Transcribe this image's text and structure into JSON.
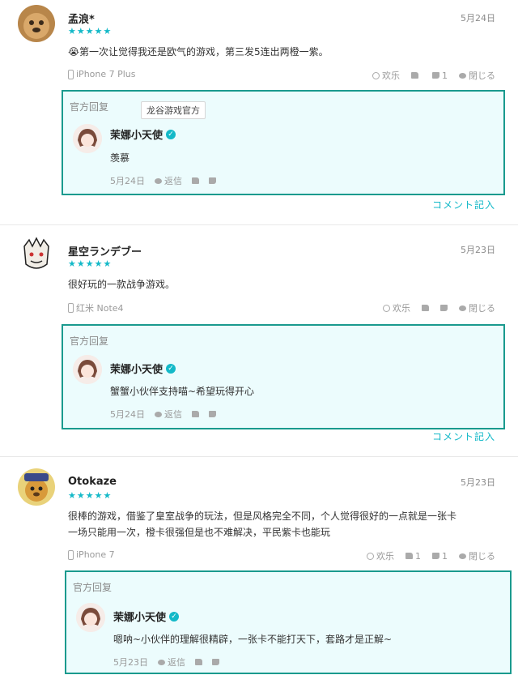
{
  "reviews": [
    {
      "username": "孟浪*",
      "date": "5月24日",
      "stars": "★★★★★",
      "emoji": "😭",
      "text": "第一次让觉得我还是欧气的游戏，第三发5连出两橙一紫。",
      "device": "iPhone 7 Plus",
      "fun_label": "欢乐",
      "like_count": "",
      "dislike_count": "1",
      "close_label": "閉じる",
      "reply": {
        "label": "官方回复",
        "tag": "龙谷游戏官方",
        "name": "茉娜小天使",
        "text": "羡慕",
        "date": "5月24日",
        "reply_label": "返信"
      },
      "comment_link": "コメント記入"
    },
    {
      "username": "星空ランデブー",
      "date": "5月23日",
      "stars": "★★★★★",
      "text": "很好玩的一款战争游戏。",
      "device": "红米 Note4",
      "fun_label": "欢乐",
      "like_count": "",
      "dislike_count": "",
      "close_label": "閉じる",
      "reply": {
        "label": "官方回复",
        "name": "茉娜小天使",
        "text": "蟹蟹小伙伴支持喵~希望玩得开心",
        "date": "5月24日",
        "reply_label": "返信"
      },
      "comment_link": "コメント記入"
    },
    {
      "username": "Otokaze",
      "date": "5月23日",
      "stars": "★★★★★",
      "text_line1": "很棒的游戏，借鉴了皇室战争的玩法，但是风格完全不同，个人觉得很好的一点就是一张卡",
      "text_line2": "一场只能用一次，橙卡很强但是也不难解决，平民紫卡也能玩",
      "device": "iPhone 7",
      "fun_label": "欢乐",
      "like_count": "1",
      "dislike_count": "1",
      "close_label": "閉じる",
      "reply": {
        "label": "官方回复",
        "name": "茉娜小天使",
        "text": "嗯呐~小伙伴的理解很精辟，一张卡不能打天下，套路才是正解~",
        "date": "5月23日",
        "reply_label": "返信"
      }
    }
  ],
  "colors": {
    "accent": "#14b9c8",
    "reply_border": "#1a9a8e",
    "reply_bg": "#ecfcfd"
  },
  "icons": [
    "phone-icon",
    "smile-icon",
    "thumbs-up-icon",
    "thumbs-down-icon",
    "bubble-icon",
    "verified-icon",
    "star-icon"
  ]
}
